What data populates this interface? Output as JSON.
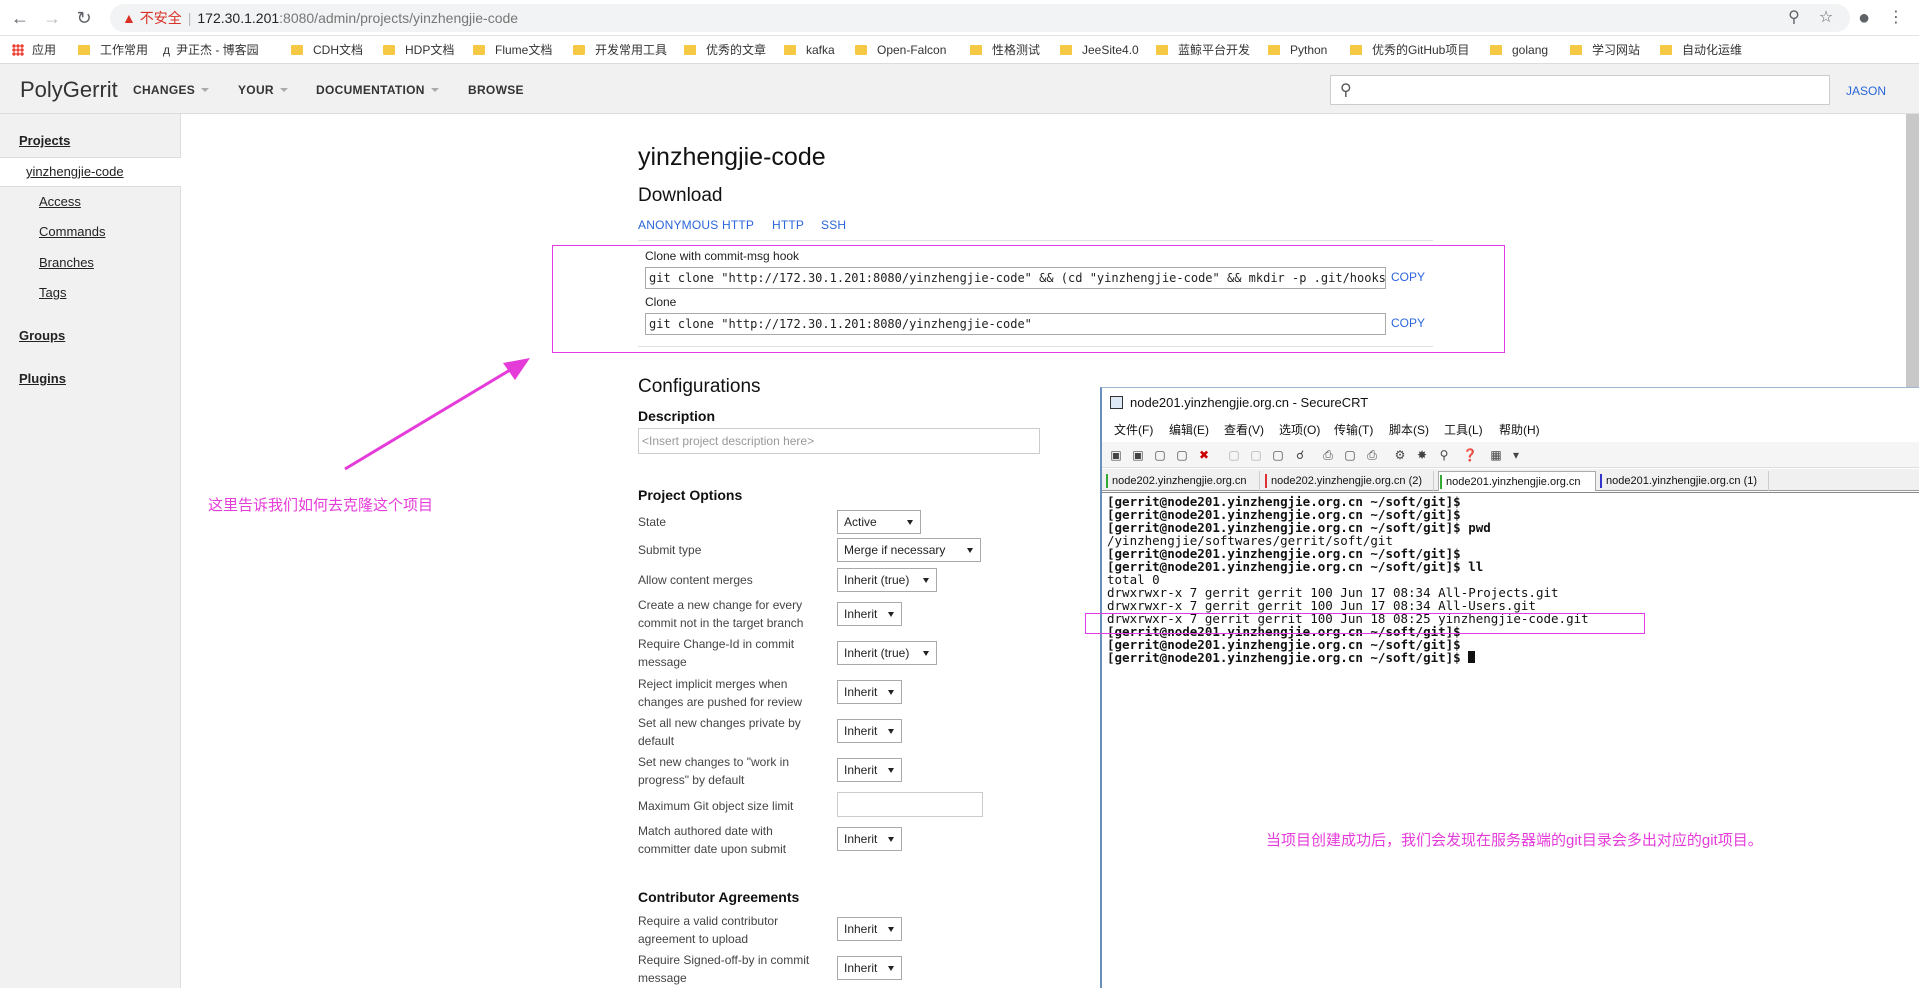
{
  "browser": {
    "url_warning": "不安全",
    "url_host": "172.30.1.201",
    "url_path": ":8080/admin/projects/yinzhengjie-code",
    "bookmarks": [
      "应用",
      "工作常用",
      "尹正杰 - 博客园",
      "CDH文档",
      "HDP文档",
      "Flume文档",
      "开发常用工具",
      "优秀的文章",
      "kafka",
      "Open-Falcon",
      "性格测试",
      "JeeSite4.0",
      "蓝鲸平台开发",
      "Python",
      "优秀的GitHub项目",
      "golang",
      "学习网站",
      "自动化运维"
    ]
  },
  "header": {
    "logo": "PolyGerrit",
    "nav": [
      "CHANGES",
      "YOUR",
      "DOCUMENTATION",
      "BROWSE"
    ],
    "search_placeholder": "",
    "user": "JASON"
  },
  "sidebar": {
    "projects": "Projects",
    "current_project": "yinzhengjie-code",
    "sub_items": [
      "Access",
      "Commands",
      "Branches",
      "Tags"
    ],
    "groups": "Groups",
    "plugins": "Plugins"
  },
  "main": {
    "title": "yinzhengjie-code",
    "download_heading": "Download",
    "download_tabs": [
      "ANONYMOUS HTTP",
      "HTTP",
      "SSH"
    ],
    "clone_hook_label": "Clone with commit-msg hook",
    "clone_hook_cmd": "git clone \"http://172.30.1.201:8080/yinzhengjie-code\" && (cd \"yinzhengjie-code\" && mkdir -p .git/hooks && curl -Lo `git rev-parse --git-dir`/hooks/commit-msg http://172.30.1.201:8080/tools/hooks/commit-msg; chmod +x `git rev-parse --git-dir`/hooks/commit-msg)",
    "clone_label": "Clone",
    "clone_cmd": "git clone \"http://172.30.1.201:8080/yinzhengjie-code\"",
    "copy_label": "COPY",
    "configurations_heading": "Configurations",
    "description_label": "Description",
    "description_placeholder": "<Insert project description here>",
    "project_options_heading": "Project Options",
    "options": [
      {
        "label": "State",
        "value": "Active"
      },
      {
        "label": "Submit type",
        "value": "Merge if necessary"
      },
      {
        "label": "Allow content merges",
        "value": "Inherit (true)"
      },
      {
        "label": "Create a new change for every commit not in the target branch",
        "value": "Inherit"
      },
      {
        "label": "Require Change-Id in commit message",
        "value": "Inherit (true)"
      },
      {
        "label": "Reject implicit merges when changes are pushed for review",
        "value": "Inherit"
      },
      {
        "label": "Set all new changes private by default",
        "value": "Inherit"
      },
      {
        "label": "Set new changes to \"work in progress\" by default",
        "value": "Inherit"
      },
      {
        "label": "Maximum Git object size limit",
        "value": ""
      },
      {
        "label": "Match authored date with committer date upon submit",
        "value": "Inherit"
      }
    ],
    "contributor_heading": "Contributor Agreements",
    "contributor_options": [
      {
        "label": "Require a valid contributor agreement to upload",
        "value": "Inherit"
      },
      {
        "label": "Require Signed-off-by in commit message",
        "value": "Inherit"
      }
    ]
  },
  "annotations": {
    "clone_note": "这里告诉我们如何去克隆这个项目",
    "server_note": "当项目创建成功后，我们会发现在服务器端的git目录会多出对应的git项目。"
  },
  "securecrt": {
    "title": "node201.yinzhengjie.org.cn - SecureCRT",
    "menu": [
      "文件(F)",
      "编辑(E)",
      "查看(V)",
      "选项(O)",
      "传输(T)",
      "脚本(S)",
      "工具(L)",
      "帮助(H)"
    ],
    "tabs": [
      "node202.yinzhengjie.org.cn",
      "node202.yinzhengjie.org.cn (2)",
      "node201.yinzhengjie.org.cn",
      "node201.yinzhengjie.org.cn (1)"
    ],
    "terminal_lines": [
      "[gerrit@node201.yinzhengjie.org.cn ~/soft/git]$",
      "[gerrit@node201.yinzhengjie.org.cn ~/soft/git]$",
      "[gerrit@node201.yinzhengjie.org.cn ~/soft/git]$ pwd",
      "/yinzhengjie/softwares/gerrit/soft/git",
      "[gerrit@node201.yinzhengjie.org.cn ~/soft/git]$",
      "[gerrit@node201.yinzhengjie.org.cn ~/soft/git]$ ll",
      "total 0",
      "drwxrwxr-x 7 gerrit gerrit 100 Jun 17 08:34 All-Projects.git",
      "drwxrwxr-x 7 gerrit gerrit 100 Jun 17 08:34 All-Users.git",
      "drwxrwxr-x 7 gerrit gerrit 100 Jun 18 08:25 yinzhengjie-code.git",
      "[gerrit@node201.yinzhengjie.org.cn ~/soft/git]$",
      "[gerrit@node201.yinzhengjie.org.cn ~/soft/git]$",
      "[gerrit@node201.yinzhengjie.org.cn ~/soft/git]$ "
    ]
  },
  "colors": {
    "link": "#2a66d9",
    "annotation": "#e53bd9",
    "header_bg": "#f1f1f1"
  }
}
